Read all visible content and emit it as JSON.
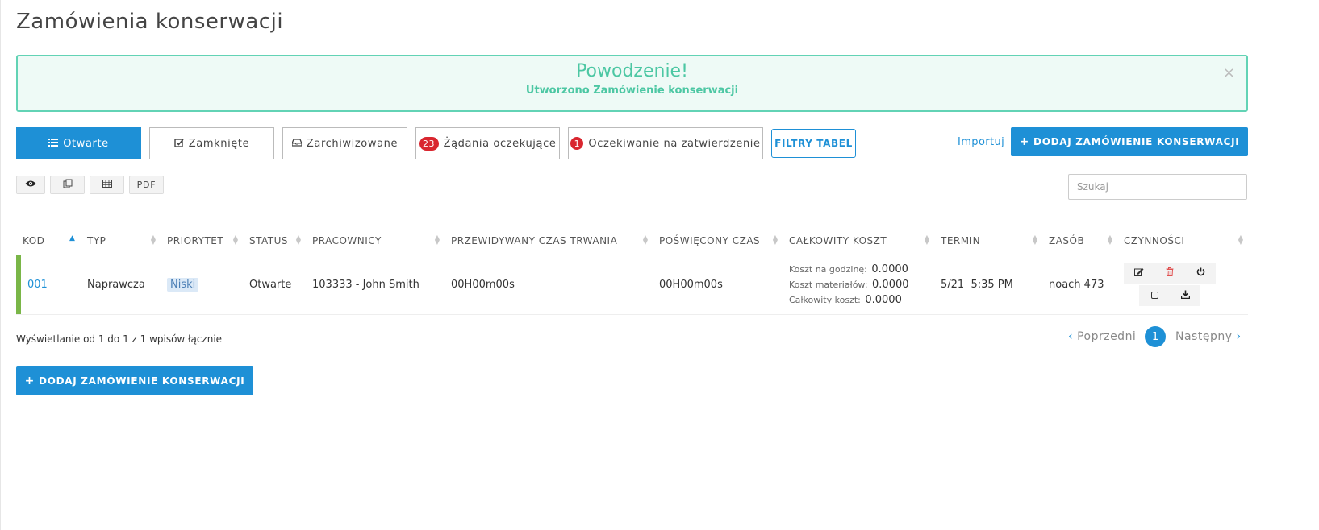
{
  "page": {
    "title": "Zamówienia konserwacji"
  },
  "alert": {
    "title": "Powodzenie!",
    "message": "Utworzono Zamówienie konserwacji",
    "close": "×"
  },
  "tabs": [
    {
      "label": "Otwarte",
      "icon": "list-icon",
      "active": true
    },
    {
      "label": "Zamknięte",
      "icon": "checkbox-icon"
    },
    {
      "label": "Zarchiwizowane",
      "icon": "inbox-icon"
    },
    {
      "label": "Żądania oczekujące",
      "badge": "23"
    },
    {
      "label": "Oczekiwanie na zatwierdzenie",
      "badge": "1"
    }
  ],
  "filters_label": "FILTRY TABEL",
  "import_label": "Importuj",
  "add_label": "DODAJ ZAMÓWIENIE KONSERWACJI",
  "tools": {
    "pdf": "PDF"
  },
  "search": {
    "placeholder": "Szukaj"
  },
  "table": {
    "headers": [
      "KOD",
      "TYP",
      "PRIORYTET",
      "STATUS",
      "PRACOWNICY",
      "PRZEWIDYWANY CZAS TRWANIA",
      "POŚWIĘCONY CZAS",
      "CAŁKOWITY KOSZT",
      "TERMIN",
      "ZASÓB",
      "CZYNNOŚCI"
    ],
    "rows": [
      {
        "code": "001",
        "type": "Naprawcza",
        "priority": "Niski",
        "status": "Otwarte",
        "workers": "103333 - John Smith",
        "estimated_duration": "00H00m00s",
        "time_spent": "00H00m00s",
        "cost": {
          "hourly_label": "Koszt na godzinę:",
          "hourly": "0.0000",
          "materials_label": "Koszt materiałów:",
          "materials": "0.0000",
          "total_label": "Całkowity koszt:",
          "total": "0.0000"
        },
        "due": "5/21  5:35 PM",
        "asset": "noach 473",
        "row_color": "#7ab648"
      }
    ]
  },
  "pagination": {
    "info": "Wyświetlanie od 1 do 1 z 1 wpisów łącznie",
    "prev": "Poprzedni",
    "next": "Następny",
    "current": "1"
  },
  "colors": {
    "primary": "#1e90d6",
    "success": "#4cc7a3",
    "danger": "#d9262f"
  }
}
